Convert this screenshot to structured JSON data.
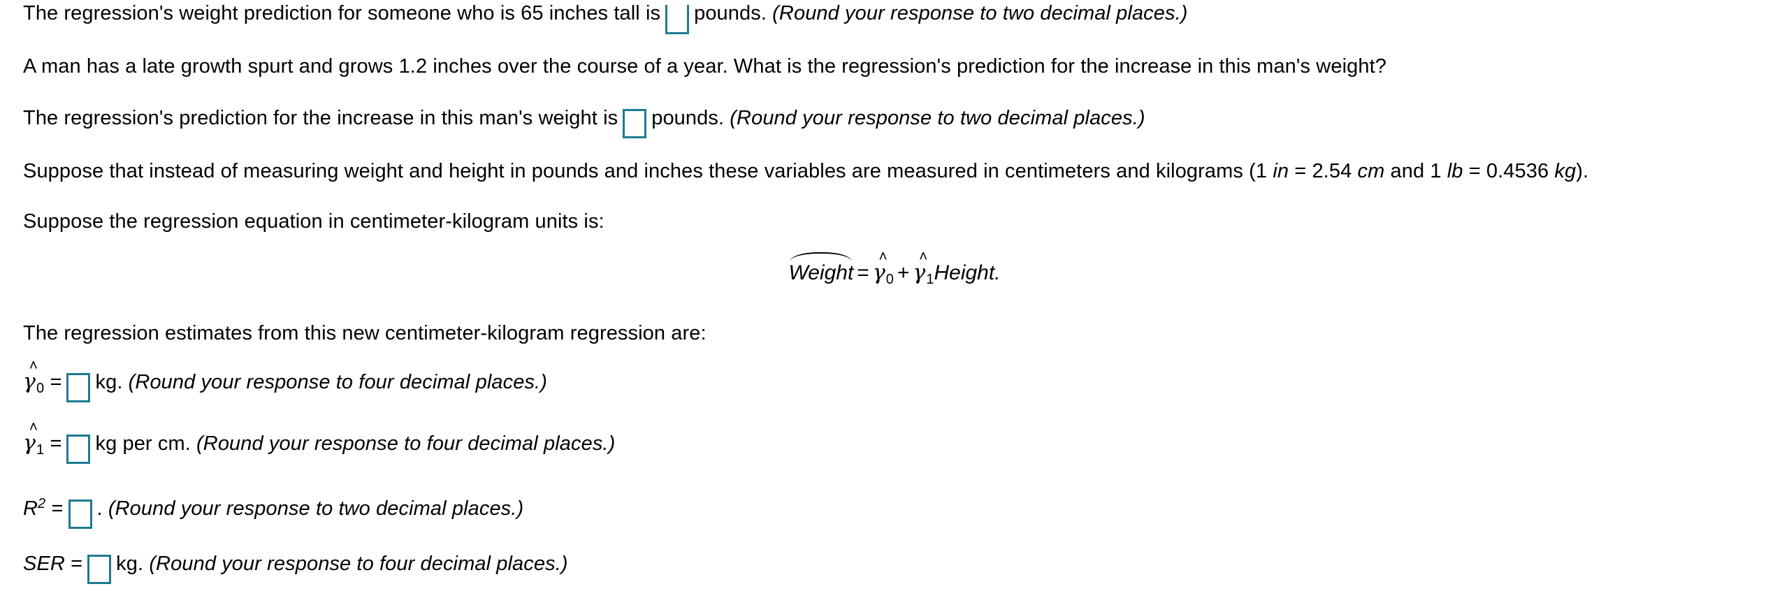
{
  "document": {
    "type": "homework-question",
    "accent_color": "#1d7a91",
    "text_color": "#000000",
    "background_color": "#ffffff"
  },
  "lines": {
    "l1": {
      "before_input": "The regression's weight prediction for someone who is 65 inches tall is",
      "after_input": "pounds.",
      "note": "(Round your response to two decimal places.)",
      "input_value": "",
      "input_placeholder": ""
    },
    "l2": {
      "text": "A man has a late growth spurt and grows 1.2 inches over the course of a year. What is the regression's prediction for the increase in this man's weight?"
    },
    "l3": {
      "before_input": "The regression's prediction for the increase in this man's weight is",
      "after_input": "pounds.",
      "note": "(Round your response to two decimal places.)",
      "input_value": "",
      "input_placeholder": ""
    },
    "l4": {
      "part1": "Suppose that instead of measuring weight and height in pounds and inches these variables are measured in centimeters and kilograms (1",
      "unit_in": "in",
      "part2": "= 2.54",
      "unit_cm": "cm",
      "part3": "and 1",
      "unit_lb": "lb",
      "part4": "= 0.4536",
      "unit_kg": "kg",
      "part5": ")."
    },
    "l5": {
      "text": "Suppose the regression equation in centimeter-kilogram units is:"
    },
    "equation": {
      "lhs": "Weight",
      "equals": "=",
      "gamma": "γ",
      "hat": "˄",
      "sub0": "0",
      "plus": "+",
      "sub1": "1",
      "rhs_var": "Height."
    },
    "l6": {
      "text": "The regression estimates from this new centimeter-kilogram regression are:"
    },
    "gamma0_line": {
      "gamma": "γ",
      "hat": "˄",
      "sub": "0",
      "equals": "=",
      "unit": "kg.",
      "note": "(Round your response to four decimal places.)",
      "input_value": "",
      "input_placeholder": ""
    },
    "gamma1_line": {
      "gamma": "γ",
      "hat": "˄",
      "sub": "1",
      "equals": "=",
      "unit": "kg per cm.",
      "note": "(Round your response to four decimal places.)",
      "input_value": "",
      "input_placeholder": ""
    },
    "r2_line": {
      "symbol": "R",
      "exponent": "2",
      "equals": "=",
      "unit": ".",
      "note": "(Round your response to two decimal places.)",
      "input_value": "",
      "input_placeholder": ""
    },
    "ser_line": {
      "symbol": "SER",
      "equals": "=",
      "unit": "kg.",
      "note": "(Round your response to four decimal places.)",
      "input_value": "",
      "input_placeholder": ""
    }
  }
}
